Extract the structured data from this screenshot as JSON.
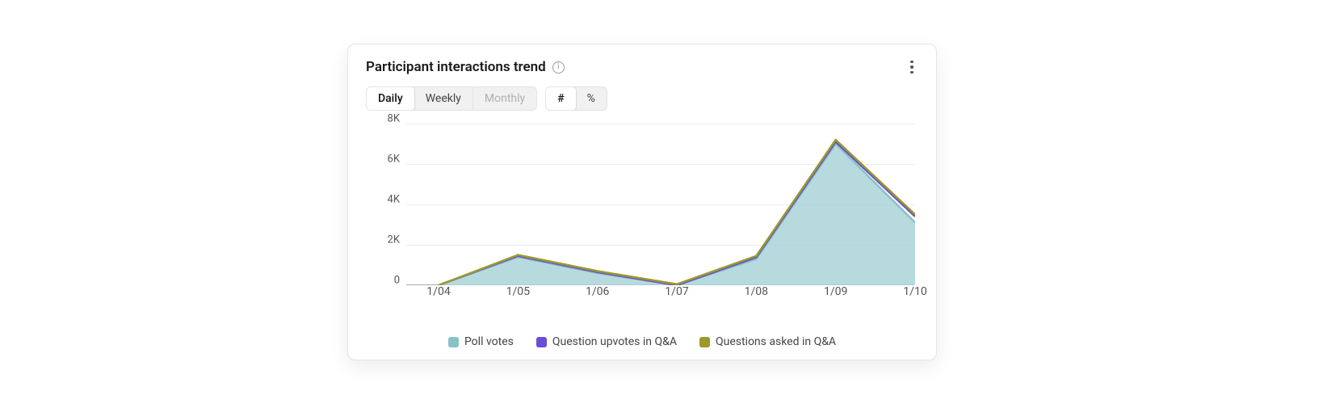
{
  "card": {
    "title": "Participant interactions trend",
    "info_tooltip": "i"
  },
  "controls": {
    "range": {
      "daily": "Daily",
      "weekly": "Weekly",
      "monthly": "Monthly",
      "active": "daily",
      "disabled": [
        "monthly"
      ]
    },
    "mode": {
      "count": "#",
      "percent": "%",
      "active": "count"
    }
  },
  "chart_data": {
    "type": "area",
    "title": "Participant interactions trend",
    "xlabel": "",
    "ylabel": "",
    "categories": [
      "1/04",
      "1/05",
      "1/06",
      "1/07",
      "1/08",
      "1/09",
      "1/10"
    ],
    "series": [
      {
        "name": "Poll votes",
        "color": "#88c2c7",
        "values": [
          0,
          1400,
          600,
          0,
          1300,
          7000,
          3100
        ]
      },
      {
        "name": "Question upvotes in Q&A",
        "color": "#6b4cd6",
        "values": [
          0,
          1450,
          650,
          0,
          1380,
          7100,
          3400
        ]
      },
      {
        "name": "Questions asked in Q&A",
        "color": "#9a9a2a",
        "values": [
          0,
          1500,
          700,
          50,
          1450,
          7200,
          3500
        ]
      }
    ],
    "ylim": [
      0,
      8000
    ],
    "y_ticks": [
      0,
      2000,
      4000,
      6000,
      8000
    ],
    "y_tick_labels": [
      "0",
      "2K",
      "4K",
      "6K",
      "8K"
    ],
    "grid": true,
    "legend_position": "bottom"
  }
}
